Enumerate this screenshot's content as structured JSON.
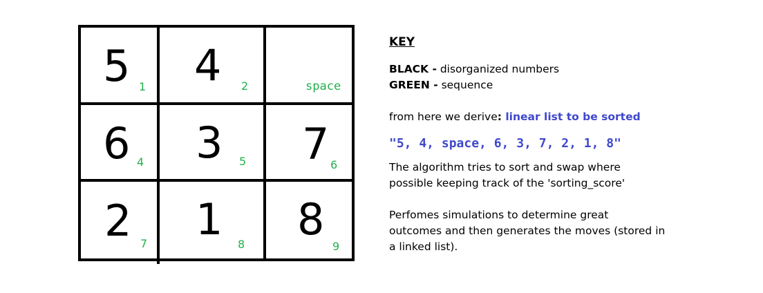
{
  "puzzle": {
    "cells": [
      {
        "number": "5",
        "seq": "1"
      },
      {
        "number": "4",
        "seq": "2"
      },
      {
        "number": "",
        "seq": "space"
      },
      {
        "number": "6",
        "seq": "4"
      },
      {
        "number": "3",
        "seq": "5"
      },
      {
        "number": "7",
        "seq": "6"
      },
      {
        "number": "2",
        "seq": "7"
      },
      {
        "number": "1",
        "seq": "8"
      },
      {
        "number": "8",
        "seq": "9"
      }
    ]
  },
  "key": {
    "title": "KEY",
    "black_label": "BLACK -",
    "black_desc": " disorganized numbers",
    "green_label": "GREEN -",
    "green_desc": " sequence",
    "derive_prefix": "from here we derive",
    "derive_colon": ":",
    "derive_emphasis": " linear list to be sorted",
    "linear_list": "\"5, 4, space, 6, 3, 7, 2, 1, 8\"",
    "algorithm_line1": "The algorithm tries to sort and swap where",
    "algorithm_line2": "possible keeping track of the 'sorting_score'",
    "sim_line1": "Perfomes simulations to determine great",
    "sim_line2": "outcomes and then generates the moves (stored in",
    "sim_line3": "a linked list)."
  },
  "colors": {
    "number": "#000000",
    "sequence": "#22b14c",
    "highlight": "#3f48cc"
  }
}
